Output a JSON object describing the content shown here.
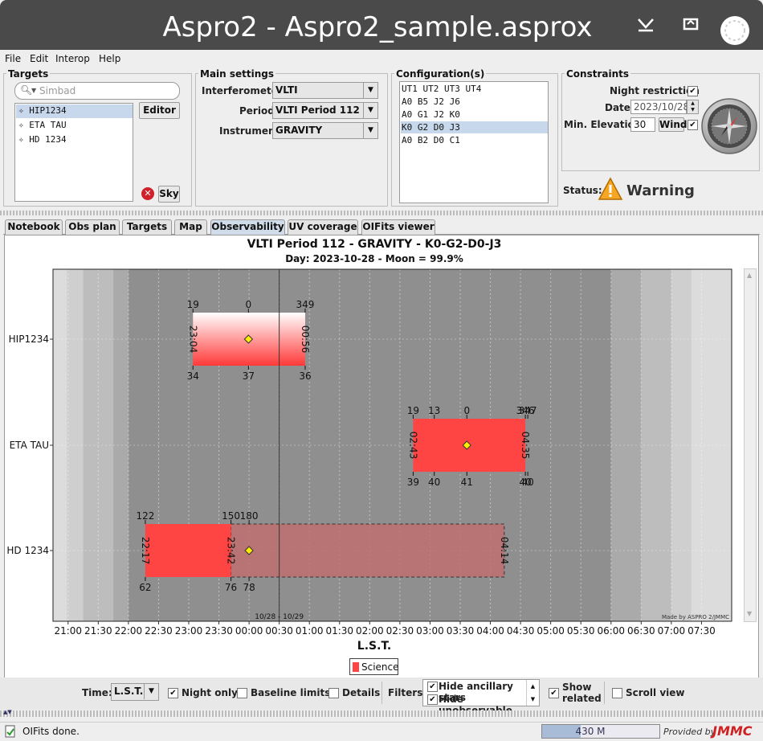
{
  "window": {
    "title": "Aspro2 - Aspro2_sample.asprox"
  },
  "menu": [
    "File",
    "Edit",
    "Interop",
    "Help"
  ],
  "targets": {
    "title": "Targets",
    "search_placeholder": "Simbad",
    "items": [
      "HIP1234",
      "ETA TAU",
      "HD 1234"
    ],
    "editor_label": "Editor",
    "sky_label": "Sky"
  },
  "main_settings": {
    "title": "Main settings",
    "interferometer_label": "Interferometer",
    "interferometer_value": "VLTI",
    "period_label": "Period",
    "period_value": "VLTI Period 112",
    "instrument_label": "Instrument",
    "instrument_value": "GRAVITY"
  },
  "configurations": {
    "title": "Configuration(s)",
    "items": [
      "UT1 UT2 UT3 UT4",
      "A0 B5 J2 J6",
      "A0 G1 J2 K0",
      "K0 G2 D0 J3",
      "A0 B2 D0 C1"
    ],
    "selected": "K0 G2 D0 J3"
  },
  "constraints": {
    "title": "Constraints",
    "night_restriction_label": "Night restriction",
    "night_restriction": true,
    "date_label": "Date",
    "date_value": "2023/10/28",
    "min_elevation_label": "Min. Elevation",
    "min_elevation_value": "30",
    "wind_label": "Wind",
    "wind": true
  },
  "status": {
    "label": "Status:",
    "value": "Warning"
  },
  "tabs": [
    "Notebook",
    "Obs plan",
    "Targets",
    "Map",
    "Observability",
    "UV coverage",
    "OIFits viewer"
  ],
  "active_tab": "Observability",
  "plot": {
    "title": "VLTI Period 112 - GRAVITY - K0-G2-D0-J3",
    "subtitle": "Day: 2023-10-28 - Moon = 99.9%",
    "xlabel": "L.S.T.",
    "date_marker": "10/28 - 10/29",
    "credit": "Made by ASPRO 2/JMMC",
    "legend_label": "Science",
    "legend_color": "#ff4444"
  },
  "chart_data": {
    "type": "bar",
    "title": "VLTI Period 112 - GRAVITY - K0-G2-D0-J3",
    "subtitle": "Day: 2023-10-28 - Moon = 99.9%",
    "xlabel": "L.S.T.",
    "x_ticks": [
      "21:00",
      "21:30",
      "22:00",
      "22:30",
      "23:00",
      "23:30",
      "00:00",
      "00:30",
      "01:00",
      "01:30",
      "02:00",
      "02:30",
      "03:00",
      "03:30",
      "04:00",
      "04:30",
      "05:00",
      "05:30",
      "06:00",
      "06:30",
      "07:00",
      "07:30"
    ],
    "xlim_hours": [
      20.75,
      32.0
    ],
    "categories": [
      "HIP1234",
      "ETA TAU",
      "HD 1234"
    ],
    "targets": [
      {
        "name": "HIP1234",
        "start_label": "23:04",
        "end_label": "00:56",
        "start": 23.07,
        "end": 24.93,
        "transit": 23.99,
        "top_labels": [
          {
            "h": 23.07,
            "t": "19"
          },
          {
            "h": 23.99,
            "t": "0"
          },
          {
            "h": 24.93,
            "t": "349"
          }
        ],
        "bottom_labels": [
          {
            "h": 23.07,
            "t": "34"
          },
          {
            "h": 23.99,
            "t": "37"
          },
          {
            "h": 24.93,
            "t": "36"
          }
        ],
        "style": "gradient"
      },
      {
        "name": "ETA TAU",
        "start_label": "02:43",
        "end_label": "04:35",
        "start": 26.72,
        "end": 28.58,
        "transit": 27.61,
        "top_labels": [
          {
            "h": 26.72,
            "t": "19"
          },
          {
            "h": 27.07,
            "t": "13"
          },
          {
            "h": 27.61,
            "t": "0"
          },
          {
            "h": 28.58,
            "t": "346"
          },
          {
            "h": 28.62,
            "t": "347"
          }
        ],
        "bottom_labels": [
          {
            "h": 26.72,
            "t": "39"
          },
          {
            "h": 27.07,
            "t": "40"
          },
          {
            "h": 27.61,
            "t": "41"
          },
          {
            "h": 28.58,
            "t": "40"
          },
          {
            "h": 28.62,
            "t": "40"
          }
        ],
        "style": "solid"
      },
      {
        "name": "HD 1234",
        "start_label": "22:17",
        "end_label": "23:42",
        "extended_end_label": "04:14",
        "start": 22.28,
        "end": 23.7,
        "extended_end": 28.23,
        "transit": 24.0,
        "top_labels": [
          {
            "h": 22.28,
            "t": "122"
          },
          {
            "h": 23.7,
            "t": "150"
          },
          {
            "h": 24.0,
            "t": "180"
          }
        ],
        "bottom_labels": [
          {
            "h": 22.28,
            "t": "62"
          },
          {
            "h": 23.7,
            "t": "76"
          },
          {
            "h": 24.0,
            "t": "78"
          }
        ],
        "style": "solid_plus_dashed"
      }
    ],
    "date_change_hour": 24.5,
    "legend": "Science"
  },
  "bottom": {
    "time_label": "Time:",
    "time_value": "L.S.T.",
    "night_only_label": "Night only",
    "night_only": true,
    "baseline_limits_label": "Baseline limits",
    "baseline_limits": false,
    "details_label": "Details",
    "details": false,
    "filters_label": "Filters:",
    "filters": [
      "Hide ancillary stars",
      "Hide unobservable"
    ],
    "show_related_label_1": "Show",
    "show_related_label_2": "related",
    "show_related": true,
    "scroll_view_label": "Scroll view",
    "scroll_view": false
  },
  "statusbar": {
    "message": "OIFits done.",
    "memory": "430 M",
    "memory_fraction": 0.33,
    "provided_by": "Provided by",
    "brand": "JMMC"
  }
}
